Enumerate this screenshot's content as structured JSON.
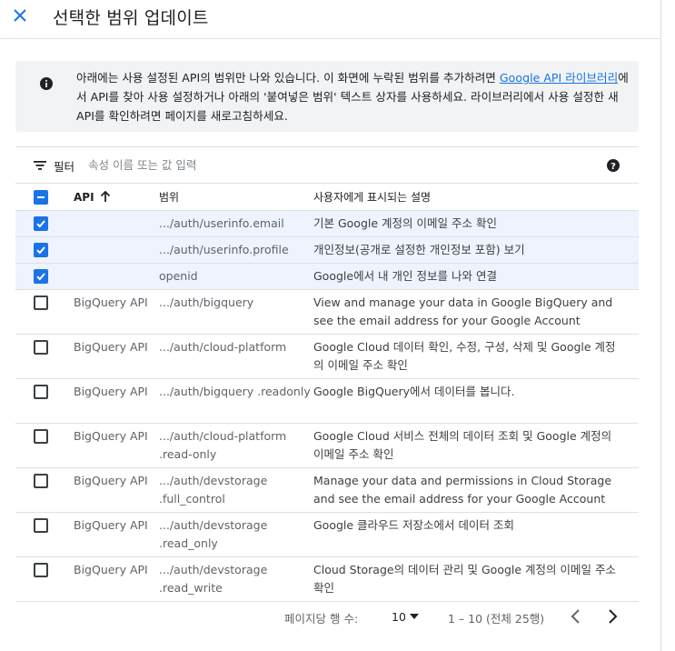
{
  "header": {
    "title": "선택한 범위 업데이트",
    "close_icon": "close-icon"
  },
  "info": {
    "text_before_link": "아래에는 사용 설정된 API의 범위만 나와 있습니다. 이 화면에 누락된 범위를 추가하려면 ",
    "link_text": "Google API 라이브러리",
    "text_after_link": "에서 API를 찾아 사용 설정하거나 아래의 '붙여넣은 범위' 텍스트 상자를 사용하세요. 라이브러리에서 사용 설정한 새 API를 확인하려면 페이지를 새로고침하세요.",
    "icon": "info-icon"
  },
  "filter": {
    "label": "필터",
    "placeholder": "속성 이름 또는 값 입력",
    "icon": "filter-icon",
    "help_icon": "help-icon"
  },
  "table": {
    "columns": {
      "api": "API",
      "scope": "범위",
      "description": "사용자에게 표시되는 설명"
    },
    "select_all_state": "indeterminate",
    "sort_icon": "arrow-up-icon",
    "rows": [
      {
        "checked": true,
        "api": "",
        "scope": ".../auth/userinfo.email",
        "description": "기본 Google 계정의 이메일 주소 확인"
      },
      {
        "checked": true,
        "api": "",
        "scope": ".../auth/userinfo.profile",
        "description": "개인정보(공개로 설정한 개인정보 포함) 보기"
      },
      {
        "checked": true,
        "api": "",
        "scope": "openid",
        "description": "Google에서 내 개인 정보를 나와 연결"
      },
      {
        "checked": false,
        "api": "BigQuery API",
        "scope": ".../auth/bigquery",
        "description": "View and manage your data in Google BigQuery and see the email address for your Google Account"
      },
      {
        "checked": false,
        "api": "BigQuery API",
        "scope": ".../auth/cloud-platform",
        "description": "Google Cloud 데이터 확인, 수정, 구성, 삭제 및 Google 계정의 이메일 주소 확인"
      },
      {
        "checked": false,
        "api": "BigQuery API",
        "scope": ".../auth/bigquery .readonly",
        "description": "Google BigQuery에서 데이터를 봅니다."
      },
      {
        "checked": false,
        "api": "BigQuery API",
        "scope": ".../auth/cloud-platform .read-only",
        "description": "Google Cloud 서비스 전체의 데이터 조회 및 Google 계정의 이메일 주소 확인"
      },
      {
        "checked": false,
        "api": "BigQuery API",
        "scope": ".../auth/devstorage .full_control",
        "description": "Manage your data and permissions in Cloud Storage and see the email address for your Google Account"
      },
      {
        "checked": false,
        "api": "BigQuery API",
        "scope": ".../auth/devstorage .read_only",
        "description": "Google 클라우드 저장소에서 데이터 조회"
      },
      {
        "checked": false,
        "api": "BigQuery API",
        "scope": ".../auth/devstorage .read_write",
        "description": "Cloud Storage의 데이터 관리 및 Google 계정의 이메일 주소 확인"
      }
    ]
  },
  "pager": {
    "rows_per_page_label": "페이지당 행 수:",
    "rows_per_page_value": "10",
    "range_text": "1 – 10 (전체 25행)",
    "prev_icon": "chevron-left-icon",
    "next_icon": "chevron-right-icon"
  },
  "colors": {
    "accent": "#1a73e8",
    "selected_row_bg": "#eef3fd",
    "info_bg": "#f1f3f4"
  }
}
